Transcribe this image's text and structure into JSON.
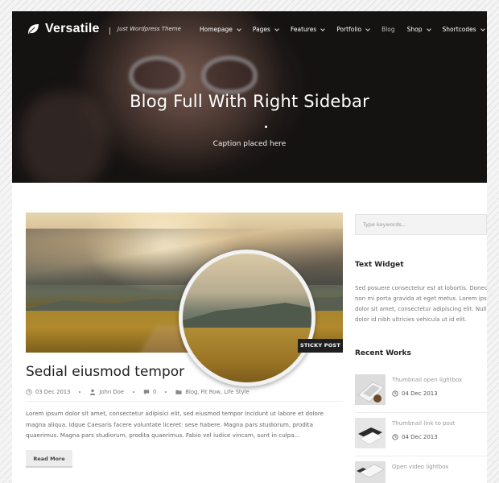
{
  "brand": {
    "name": "Versatile",
    "tagline": "Just Wordpress Theme"
  },
  "nav": {
    "items": [
      {
        "label": "Homepage",
        "has_caret": true,
        "active": false
      },
      {
        "label": "Pages",
        "has_caret": true,
        "active": false
      },
      {
        "label": "Features",
        "has_caret": true,
        "active": false
      },
      {
        "label": "Portfolio",
        "has_caret": true,
        "active": false
      },
      {
        "label": "Blog",
        "has_caret": false,
        "active": true
      },
      {
        "label": "Shop",
        "has_caret": true,
        "active": false
      },
      {
        "label": "Shortcodes",
        "has_caret": true,
        "active": false
      }
    ]
  },
  "hero": {
    "title": "Blog Full With Right Sidebar",
    "caption": "Caption placed here"
  },
  "post": {
    "badge": "STICKY POST",
    "title": "Sedial eiusmod tempor",
    "meta": {
      "date": "03 Dec 2013",
      "author": "John Doe",
      "comments": "0",
      "categories": "Blog, Fit Row, Life Style"
    },
    "excerpt": "Lorem ipsum dolor sit amet, consectetur adipisici elit, sed eiusmod tempor incidunt ut labore et dolore magna aliqua. Idque Caesaris facere voluntate liceret: sese habere. Magna pars studiorum, prodita quaerimus. Magna pars studiorum, prodita quaerimus. Fabio vel iudice vincam, sunt in culpa...",
    "read_more": "Read More"
  },
  "sidebar": {
    "search_placeholder": "Type keywords...",
    "text_widget": {
      "title": "Text Widget",
      "lines": [
        "Sed posuere consectetur est at lobortis. Donec id",
        "non mi porta gravida at eget metus. Lorem ipsum",
        "dolor sit amet, consectetur adipiscing elit. Nullam",
        "dolor id nibh ultricies vehicula ut id elit."
      ]
    },
    "recent_works": {
      "title": "Recent Works",
      "items": [
        {
          "title": "Thumbnail open lightbox",
          "date": "04 Dec 2013"
        },
        {
          "title": "Thumbnail link to post",
          "date": "04 Dec 2013"
        },
        {
          "title": "Open video lightbox",
          "date": ""
        }
      ]
    }
  },
  "colors": {
    "accent": "#1f1f1f",
    "text": "#222222",
    "muted": "#777777"
  }
}
